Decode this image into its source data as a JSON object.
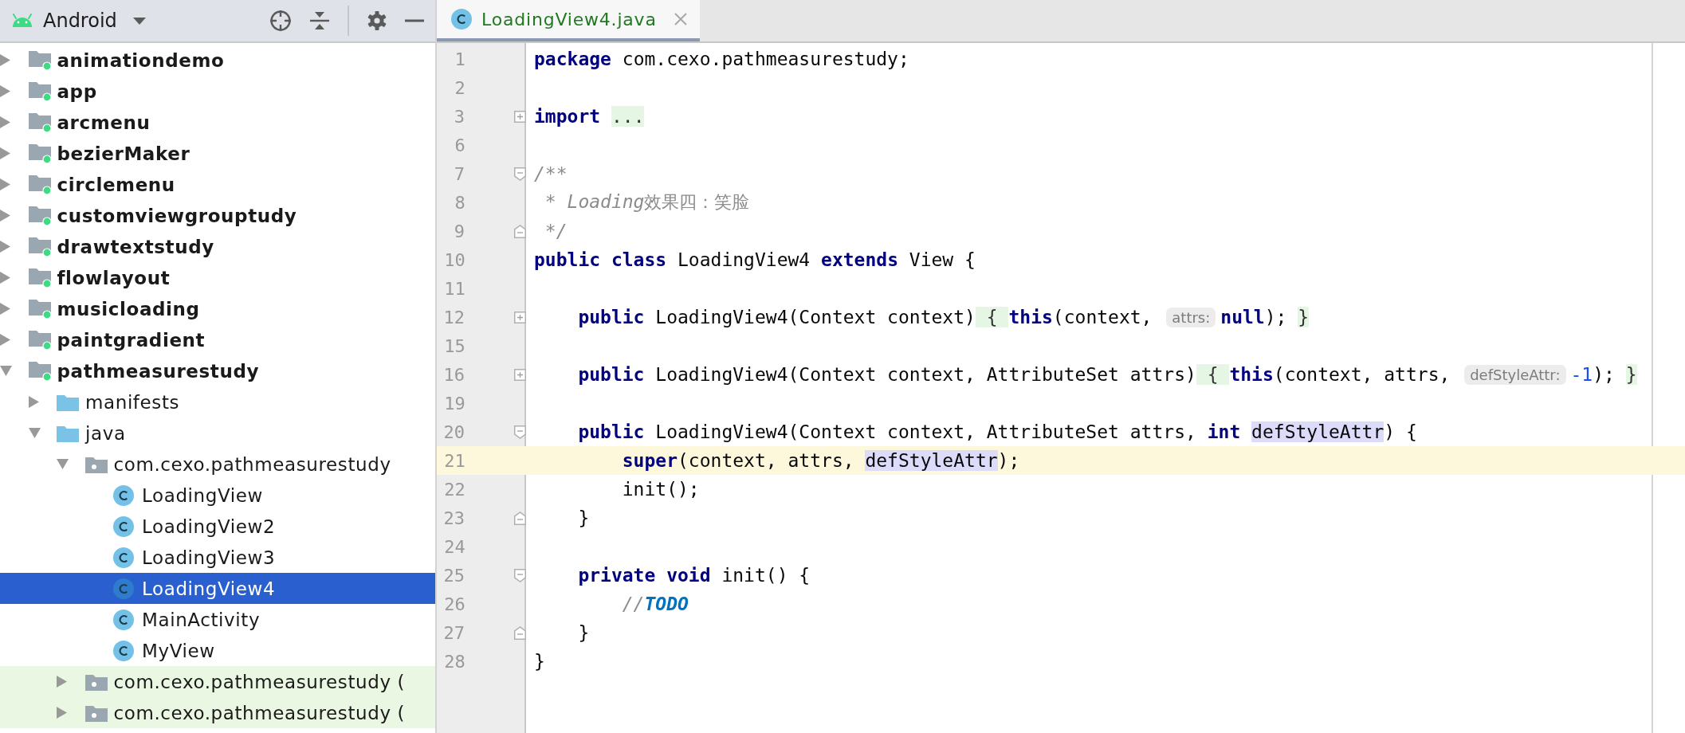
{
  "project_panel": {
    "view": "Android"
  },
  "tree": [
    {
      "label": "animationdemo",
      "kind": "module",
      "expanded": false,
      "selected": false
    },
    {
      "label": "app",
      "kind": "module",
      "expanded": false,
      "selected": false
    },
    {
      "label": "arcmenu",
      "kind": "module",
      "expanded": false,
      "selected": false
    },
    {
      "label": "bezierMaker",
      "kind": "module",
      "expanded": false,
      "selected": false
    },
    {
      "label": "circlemenu",
      "kind": "module",
      "expanded": false,
      "selected": false
    },
    {
      "label": "customviewgrouptudy",
      "kind": "module",
      "expanded": false,
      "selected": false
    },
    {
      "label": "drawtextstudy",
      "kind": "module",
      "expanded": false,
      "selected": false
    },
    {
      "label": "flowlayout",
      "kind": "module",
      "expanded": false,
      "selected": false
    },
    {
      "label": "musicloading",
      "kind": "module",
      "expanded": false,
      "selected": false
    },
    {
      "label": "paintgradient",
      "kind": "module",
      "expanded": false,
      "selected": false
    },
    {
      "label": "pathmeasurestudy",
      "kind": "module",
      "expanded": true,
      "selected": false,
      "children": [
        {
          "label": "manifests",
          "kind": "folder",
          "expanded": false,
          "selected": false
        },
        {
          "label": "java",
          "kind": "folder",
          "expanded": true,
          "selected": false,
          "children": [
            {
              "label": "com.cexo.pathmeasurestudy",
              "kind": "package",
              "expanded": true,
              "selected": false,
              "highlighted": false,
              "children": [
                {
                  "label": "LoadingView",
                  "kind": "class",
                  "selected": false
                },
                {
                  "label": "LoadingView2",
                  "kind": "class",
                  "selected": false
                },
                {
                  "label": "LoadingView3",
                  "kind": "class",
                  "selected": false
                },
                {
                  "label": "LoadingView4",
                  "kind": "class",
                  "selected": true
                },
                {
                  "label": "MainActivity",
                  "kind": "class",
                  "selected": false
                },
                {
                  "label": "MyView",
                  "kind": "class",
                  "selected": false
                }
              ]
            },
            {
              "label": "com.cexo.pathmeasurestudy (",
              "kind": "package",
              "expanded": false,
              "selected": false,
              "highlighted": true
            },
            {
              "label": "com.cexo.pathmeasurestudy (",
              "kind": "package",
              "expanded": false,
              "selected": false,
              "highlighted": true
            }
          ]
        }
      ]
    }
  ],
  "tabs": [
    {
      "label": "LoadingView4.java",
      "selected": true
    }
  ],
  "lines": [
    {
      "number": "1",
      "current": false,
      "tokens": [
        {
          "kind": "keyword",
          "text": "package"
        },
        {
          "kind": "plain",
          "text": " com.cexo.pathmeasurestudy;"
        }
      ]
    },
    {
      "number": "2",
      "current": false
    },
    {
      "number": "3",
      "current": false,
      "fold": {
        "kind": "expand"
      },
      "tokens": [
        {
          "kind": "keyword",
          "text": "import "
        },
        {
          "kind": "folded",
          "text": "..."
        }
      ]
    },
    {
      "number": "6",
      "current": false
    },
    {
      "number": "7",
      "current": false,
      "fold": {
        "kind": "start"
      },
      "tokens": [
        {
          "kind": "doc",
          "text": "/**"
        }
      ]
    },
    {
      "number": "8",
      "current": false,
      "tokens": [
        {
          "kind": "doc",
          "text": " * Loading"
        },
        {
          "kind": "doc-plain",
          "text": "效果四：笑脸"
        }
      ]
    },
    {
      "number": "9",
      "current": false,
      "fold": {
        "kind": "end"
      },
      "tokens": [
        {
          "kind": "doc",
          "text": " */"
        }
      ]
    },
    {
      "number": "10",
      "current": false,
      "tokens": [
        {
          "kind": "keyword",
          "text": "public class"
        },
        {
          "kind": "plain",
          "text": " LoadingView4 "
        },
        {
          "kind": "keyword",
          "text": "extends"
        },
        {
          "kind": "plain",
          "text": " View {"
        }
      ]
    },
    {
      "number": "11",
      "current": false
    },
    {
      "number": "12",
      "current": false,
      "fold": {
        "kind": "expand"
      },
      "tokens": [
        {
          "kind": "keyword",
          "text": "    public"
        },
        {
          "kind": "plain",
          "text": " LoadingView4(Context context)"
        },
        {
          "kind": "folded",
          "text": " { "
        },
        {
          "kind": "keyword",
          "text": "this"
        },
        {
          "kind": "plain",
          "text": "(context, "
        },
        {
          "kind": "hint",
          "text": "attrs:"
        },
        {
          "kind": "keyword",
          "text": "null"
        },
        {
          "kind": "plain",
          "text": "); "
        },
        {
          "kind": "folded",
          "text": "}"
        }
      ]
    },
    {
      "number": "15",
      "current": false
    },
    {
      "number": "16",
      "current": false,
      "fold": {
        "kind": "expand"
      },
      "tokens": [
        {
          "kind": "keyword",
          "text": "    public"
        },
        {
          "kind": "plain",
          "text": " LoadingView4(Context context, AttributeSet attrs)"
        },
        {
          "kind": "folded",
          "text": " { "
        },
        {
          "kind": "keyword",
          "text": "this"
        },
        {
          "kind": "plain",
          "text": "(context, attrs, "
        },
        {
          "kind": "hint",
          "text": "defStyleAttr:"
        },
        {
          "kind": "number",
          "text": "-1"
        },
        {
          "kind": "plain",
          "text": "); "
        },
        {
          "kind": "folded",
          "text": "}"
        }
      ]
    },
    {
      "number": "19",
      "current": false
    },
    {
      "number": "20",
      "current": false,
      "fold": {
        "kind": "start"
      },
      "tokens": [
        {
          "kind": "keyword",
          "text": "    public"
        },
        {
          "kind": "plain",
          "text": " LoadingView4(Context context, AttributeSet attrs, "
        },
        {
          "kind": "keyword",
          "text": "int "
        },
        {
          "kind": "usage",
          "text": "defStyleAttr"
        },
        {
          "kind": "plain",
          "text": ") {"
        }
      ]
    },
    {
      "number": "21",
      "current": true,
      "tokens": [
        {
          "kind": "keyword",
          "text": "        super"
        },
        {
          "kind": "plain",
          "text": "(context, attrs, "
        },
        {
          "kind": "usage",
          "text": "defStyleAttr"
        },
        {
          "kind": "plain",
          "text": ");"
        }
      ]
    },
    {
      "number": "22",
      "current": false,
      "tokens": [
        {
          "kind": "plain",
          "text": "        init();"
        }
      ]
    },
    {
      "number": "23",
      "current": false,
      "fold": {
        "kind": "end"
      },
      "tokens": [
        {
          "kind": "plain",
          "text": "    }"
        }
      ]
    },
    {
      "number": "24",
      "current": false
    },
    {
      "number": "25",
      "current": false,
      "fold": {
        "kind": "start"
      },
      "tokens": [
        {
          "kind": "keyword",
          "text": "    private void"
        },
        {
          "kind": "plain",
          "text": " init() {"
        }
      ]
    },
    {
      "number": "26",
      "current": false,
      "tokens": [
        {
          "kind": "comment",
          "text": "        //"
        },
        {
          "kind": "todo",
          "text": "TODO"
        }
      ]
    },
    {
      "number": "27",
      "current": false,
      "fold": {
        "kind": "end"
      },
      "tokens": [
        {
          "kind": "plain",
          "text": "    }"
        }
      ]
    },
    {
      "number": "28",
      "current": false,
      "tokens": [
        {
          "kind": "plain",
          "text": "}"
        }
      ]
    }
  ]
}
